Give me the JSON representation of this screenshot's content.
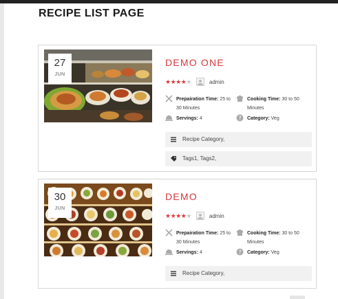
{
  "page": {
    "title": "RECIPE LIST PAGE"
  },
  "recipes": [
    {
      "date_day": "27",
      "date_month": "JUN",
      "title": "DEMO ONE",
      "rating": 4,
      "rating_max": 5,
      "author": "admin",
      "prep_label": "Prepairation Time:",
      "prep_value": "25 to 30 Minutes",
      "cook_label": "Cooking Time:",
      "cook_value": "30 to 50 Minutes",
      "servings_label": "Servings:",
      "servings_value": "4",
      "category_label": "Category:",
      "category_value": "Veg",
      "recipe_category": "Recipe Category,",
      "tags": "Tags1, Tags2,"
    },
    {
      "date_day": "30",
      "date_month": "JUN",
      "title": "DEMO",
      "rating": 4,
      "rating_max": 5,
      "author": "admin",
      "prep_label": "Prepairation Time:",
      "prep_value": "25 to 30 Minutes",
      "cook_label": "Cooking Time:",
      "cook_value": "30 to 50 Minutes",
      "servings_label": "Servings:",
      "servings_value": "4",
      "category_label": "Category:",
      "category_value": "Veg",
      "recipe_category": "Recipe Category,"
    }
  ],
  "icons": {
    "prep": "utensils-icon",
    "cook": "chef-hat-icon",
    "servings": "cloche-icon",
    "category": "help-circle-icon",
    "recipe_category": "list-icon",
    "tags": "tag-icon",
    "author": "user-avatar-icon"
  },
  "colors": {
    "accent": "#d9383c",
    "star_off": "#c6c6c6",
    "row_bg": "#f1f1f1"
  }
}
